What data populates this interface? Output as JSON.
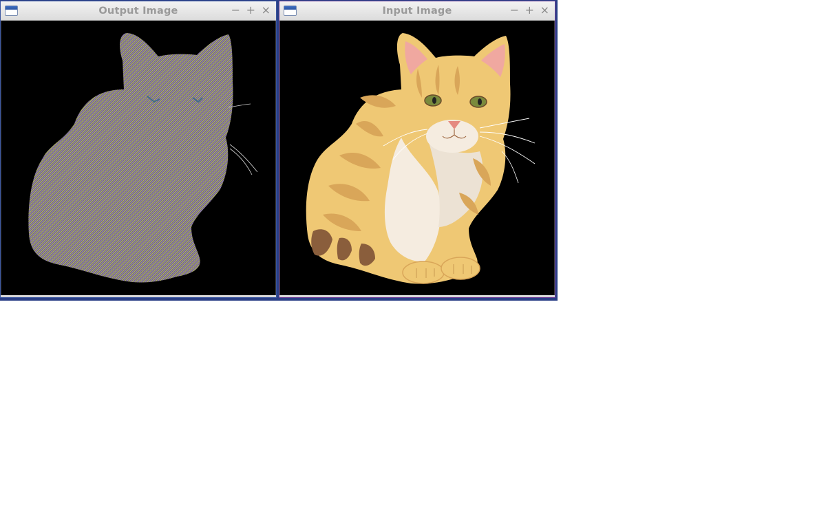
{
  "windows": [
    {
      "title": "Output Image",
      "controls": {
        "minimize": "−",
        "maximize": "+",
        "close": "×"
      },
      "icon": "window-app-icon",
      "content": "striped-silhouette-cat"
    },
    {
      "title": "Input Image",
      "controls": {
        "minimize": "−",
        "maximize": "+",
        "close": "×"
      },
      "icon": "window-app-icon",
      "content": "orange-tabby-cat"
    }
  ],
  "colors": {
    "canvas_bg": "#000000",
    "cat_base": "#efc874",
    "cat_stripes": "#d9a659",
    "cat_white": "#f5ece0",
    "cat_dark": "#8a5e3c",
    "ear_pink": "#f0a8a0",
    "eye_green": "#7a8a3c",
    "nose_pink": "#e58a80",
    "silhouette_gray": "#6e6e6e"
  }
}
